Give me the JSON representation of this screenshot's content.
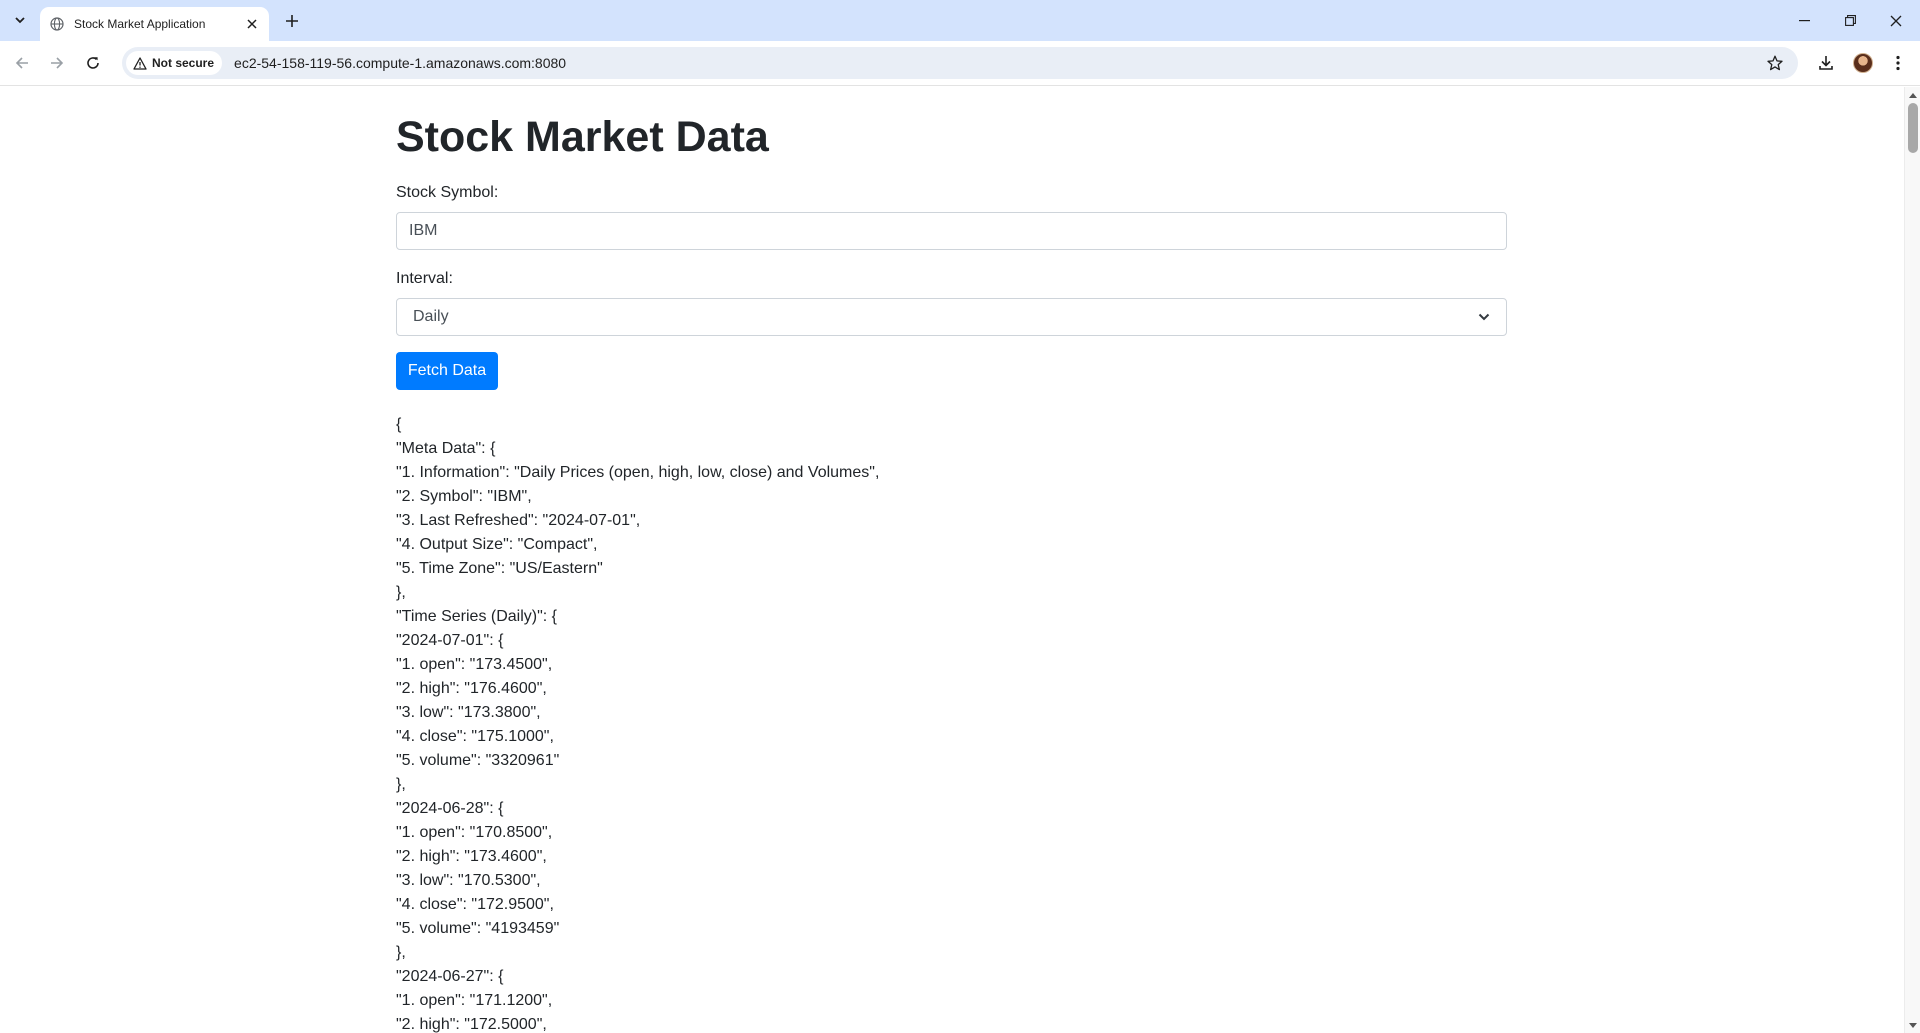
{
  "browser": {
    "tab_title": "Stock Market Application",
    "security_label": "Not secure",
    "url": "ec2-54-158-119-56.compute-1.amazonaws.com:8080"
  },
  "page": {
    "title": "Stock Market Data",
    "symbol_label": "Stock Symbol:",
    "symbol_value": "IBM",
    "interval_label": "Interval:",
    "interval_value": "Daily",
    "fetch_button": "Fetch Data"
  },
  "json_output": [
    "{",
    "\"Meta Data\": {",
    "\"1. Information\": \"Daily Prices (open, high, low, close) and Volumes\",",
    "\"2. Symbol\": \"IBM\",",
    "\"3. Last Refreshed\": \"2024-07-01\",",
    "\"4. Output Size\": \"Compact\",",
    "\"5. Time Zone\": \"US/Eastern\"",
    "},",
    "\"Time Series (Daily)\": {",
    "\"2024-07-01\": {",
    "\"1. open\": \"173.4500\",",
    "\"2. high\": \"176.4600\",",
    "\"3. low\": \"173.3800\",",
    "\"4. close\": \"175.1000\",",
    "\"5. volume\": \"3320961\"",
    "},",
    "\"2024-06-28\": {",
    "\"1. open\": \"170.8500\",",
    "\"2. high\": \"173.4600\",",
    "\"3. low\": \"170.5300\",",
    "\"4. close\": \"172.9500\",",
    "\"5. volume\": \"4193459\"",
    "},",
    "\"2024-06-27\": {",
    "\"1. open\": \"171.1200\",",
    "\"2. high\": \"172.5000\","
  ],
  "colors": {
    "tabbar": "#d3e3fd",
    "primary_button": "#007bff",
    "text": "#212529"
  }
}
